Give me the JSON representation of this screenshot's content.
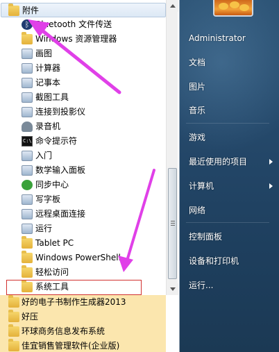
{
  "left_menu": {
    "header": {
      "label": "附件",
      "icon": "folder-icon"
    },
    "items": [
      {
        "label": "Bluetooth 文件传送",
        "icon": "bluetooth-icon"
      },
      {
        "label": "Windows 资源管理器",
        "icon": "explorer-icon"
      },
      {
        "label": "画图",
        "icon": "paint-icon"
      },
      {
        "label": "计算器",
        "icon": "calculator-icon"
      },
      {
        "label": "记事本",
        "icon": "notepad-icon"
      },
      {
        "label": "截图工具",
        "icon": "snipping-icon"
      },
      {
        "label": "连接到投影仪",
        "icon": "projector-icon"
      },
      {
        "label": "录音机",
        "icon": "microphone-icon"
      },
      {
        "label": "命令提示符",
        "icon": "cmd-icon"
      },
      {
        "label": "入门",
        "icon": "getting-started-icon"
      },
      {
        "label": "数学输入面板",
        "icon": "math-input-icon"
      },
      {
        "label": "同步中心",
        "icon": "sync-icon"
      },
      {
        "label": "写字板",
        "icon": "wordpad-icon"
      },
      {
        "label": "远程桌面连接",
        "icon": "remote-desktop-icon"
      },
      {
        "label": "运行",
        "icon": "run-icon"
      },
      {
        "label": "Tablet PC",
        "icon": "folder-icon"
      },
      {
        "label": "Windows PowerShell",
        "icon": "folder-icon"
      },
      {
        "label": "轻松访问",
        "icon": "folder-icon"
      },
      {
        "label": "系统工具",
        "icon": "folder-icon"
      }
    ],
    "bottom_folders": [
      {
        "label": "好的电子书制作生成器2013"
      },
      {
        "label": "好压"
      },
      {
        "label": "环球商务信息发布系统"
      },
      {
        "label": "佳宜销售管理软件(企业版)"
      }
    ],
    "cmd_icon_text": "C:\\"
  },
  "right_menu": {
    "items": [
      {
        "label": "Administrator",
        "has_submenu": false
      },
      {
        "label": "文档",
        "has_submenu": false
      },
      {
        "label": "图片",
        "has_submenu": false
      },
      {
        "label": "音乐",
        "has_submenu": false
      },
      {
        "label": "游戏",
        "has_submenu": false
      },
      {
        "label": "最近使用的项目",
        "has_submenu": true
      },
      {
        "label": "计算机",
        "has_submenu": true
      },
      {
        "label": "网络",
        "has_submenu": false
      },
      {
        "label": "控制面板",
        "has_submenu": false
      },
      {
        "label": "设备和打印机",
        "has_submenu": false
      },
      {
        "label": "运行...",
        "has_submenu": false
      }
    ]
  },
  "colors": {
    "annotation_arrow": "#e040e8",
    "selection_border": "#d1302f",
    "highlight_bg": "#fbe6ae"
  }
}
